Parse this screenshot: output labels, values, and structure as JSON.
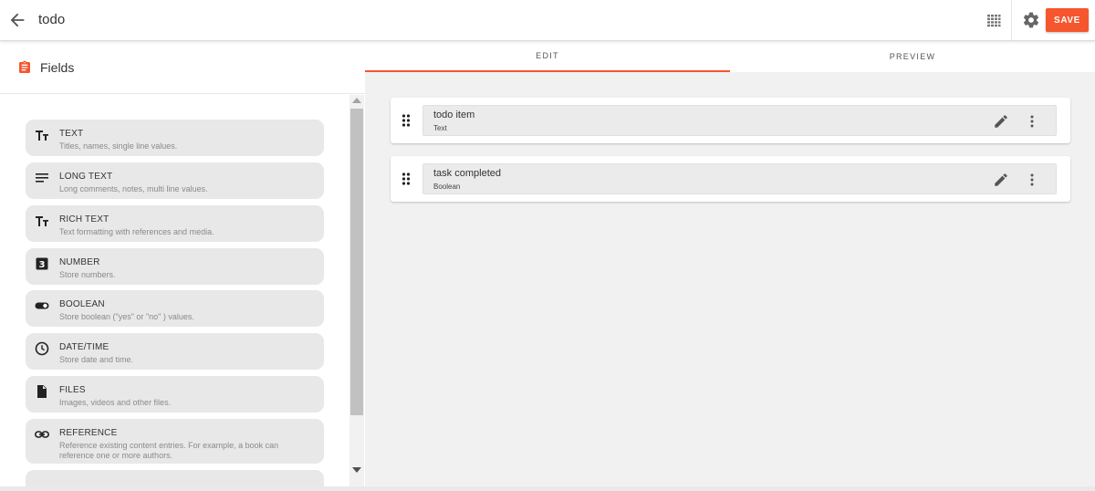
{
  "header": {
    "title": "todo",
    "save_label": "SAVE"
  },
  "colors": {
    "accent": "#f5562e",
    "panel": "#ffffff",
    "canvas": "#f1f1f1"
  },
  "sidebar": {
    "title": "Fields",
    "items": [
      {
        "name": "TEXT",
        "description": "Titles, names, single line values.",
        "icon": "text-format-icon"
      },
      {
        "name": "LONG TEXT",
        "description": "Long comments, notes, multi line values.",
        "icon": "lines-icon"
      },
      {
        "name": "RICH TEXT",
        "description": "Text formatting with references and media.",
        "icon": "text-format-icon"
      },
      {
        "name": "NUMBER",
        "description": "Store numbers.",
        "icon": "number-3-icon"
      },
      {
        "name": "BOOLEAN",
        "description": "Store boolean (\"yes\" or \"no\" ) values.",
        "icon": "toggle-icon"
      },
      {
        "name": "DATE/TIME",
        "description": "Store date and time.",
        "icon": "clock-icon"
      },
      {
        "name": "FILES",
        "description": "Images, videos and other files.",
        "icon": "file-icon"
      },
      {
        "name": "REFERENCE",
        "description": "Reference existing content entries. For example, a book can reference one or more authors.",
        "icon": "link-icon"
      }
    ]
  },
  "tabs": [
    {
      "label": "EDIT",
      "active": true
    },
    {
      "label": "PREVIEW",
      "active": false
    }
  ],
  "content": {
    "fields": [
      {
        "name": "todo item",
        "type": "Text"
      },
      {
        "name": "task completed",
        "type": "Boolean"
      }
    ]
  }
}
